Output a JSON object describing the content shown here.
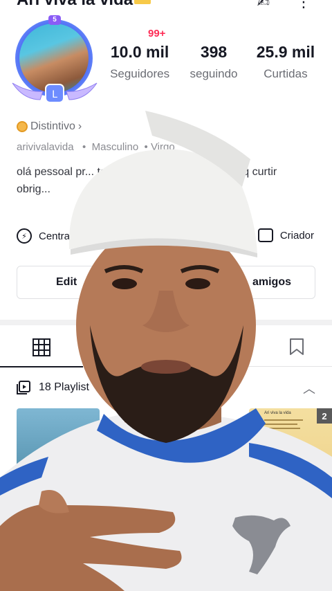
{
  "profile": {
    "display_name": "Ari viva la vida",
    "avatar_level": "5",
    "notification_badge": "99+",
    "stats": [
      {
        "value": "10.0 mil",
        "label": "Seguidores"
      },
      {
        "value": "398",
        "label": "seguindo"
      },
      {
        "value": "25.9 mil",
        "label": "Curtidas"
      }
    ],
    "badge_label": "Distintivo",
    "username": "arivivalavida",
    "gender": "Masculino",
    "sign": "Virgo",
    "bio": "olá pessoal pr... tarei aq postando un... ra vcs q curtir obrig..."
  },
  "links": {
    "left_label": "Centra",
    "right_label": "Criador"
  },
  "buttons": {
    "edit_label": "Edit",
    "friends_label": "amigos"
  },
  "playlist": {
    "label": "18 Playlist"
  },
  "thumbnails": {
    "second_title": "Ari viva la vida",
    "count": "2"
  },
  "colors": {
    "accent_red": "#fe2c55",
    "text_primary": "#161823",
    "text_secondary": "#6b6d74"
  },
  "icons": [
    "more-icon",
    "signature-icon",
    "lightning-icon",
    "store-icon",
    "grid-icon",
    "bookmark-icon",
    "playlist-icon",
    "chevron-up-icon"
  ]
}
